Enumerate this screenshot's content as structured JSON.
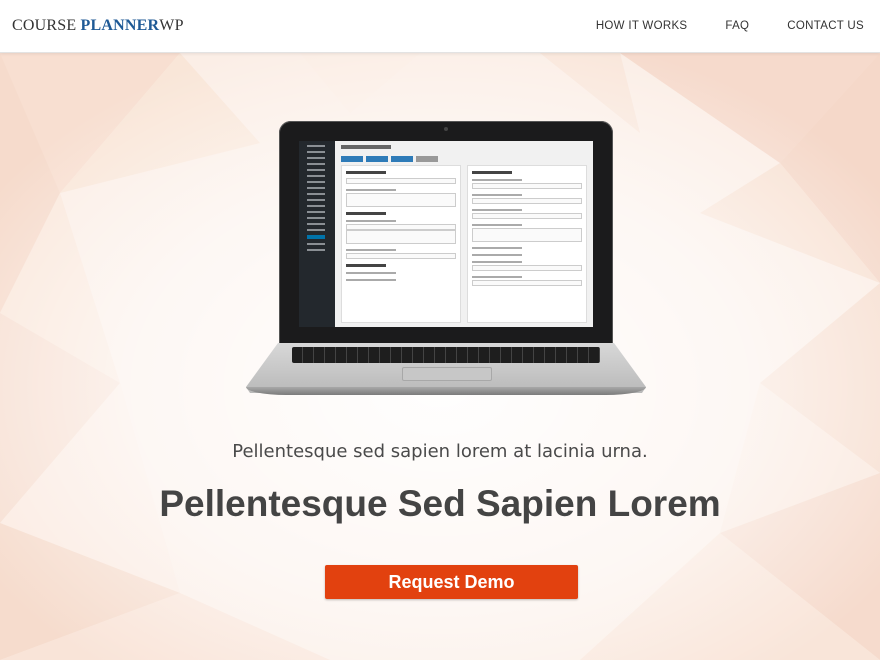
{
  "header": {
    "logo_prefix": "COURSE ",
    "logo_brand": "PLANNER",
    "logo_suffix": "WP",
    "nav": [
      {
        "label": "HOW IT WORKS"
      },
      {
        "label": "FAQ"
      },
      {
        "label": "CONTACT US"
      }
    ]
  },
  "hero": {
    "tagline": "Pellentesque sed sapien lorem at lacinia urna.",
    "headline": "Pellentesque Sed Sapien Lorem",
    "cta_label": "Request Demo"
  },
  "colors": {
    "brand_blue": "#1f5a96",
    "cta_orange": "#e2410f",
    "text_dark": "#444444"
  }
}
